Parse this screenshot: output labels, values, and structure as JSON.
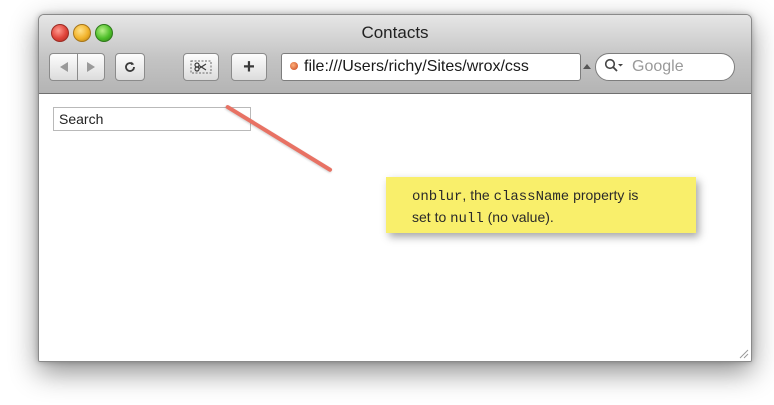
{
  "window": {
    "title": "Contacts",
    "address": "file:///Users/richy/Sites/wrox/css",
    "search_placeholder": "Google",
    "toolbar": {
      "back_icon": "back-arrow-icon",
      "forward_icon": "forward-arrow-icon",
      "reload_icon": "reload-icon",
      "snip_icon": "webclip-scissors-icon",
      "add_label": "+"
    }
  },
  "page": {
    "search_field_value": "Search"
  },
  "annotation": {
    "line1_code": "onblur",
    "line1_text_a": ", the ",
    "line1_code2": "className",
    "line1_text_b": " property is",
    "line2_text_a": "set to ",
    "line2_code": "null",
    "line2_text_b": " (no value).",
    "note_color": "#f9ef6b",
    "leader_color": "#e87264"
  }
}
